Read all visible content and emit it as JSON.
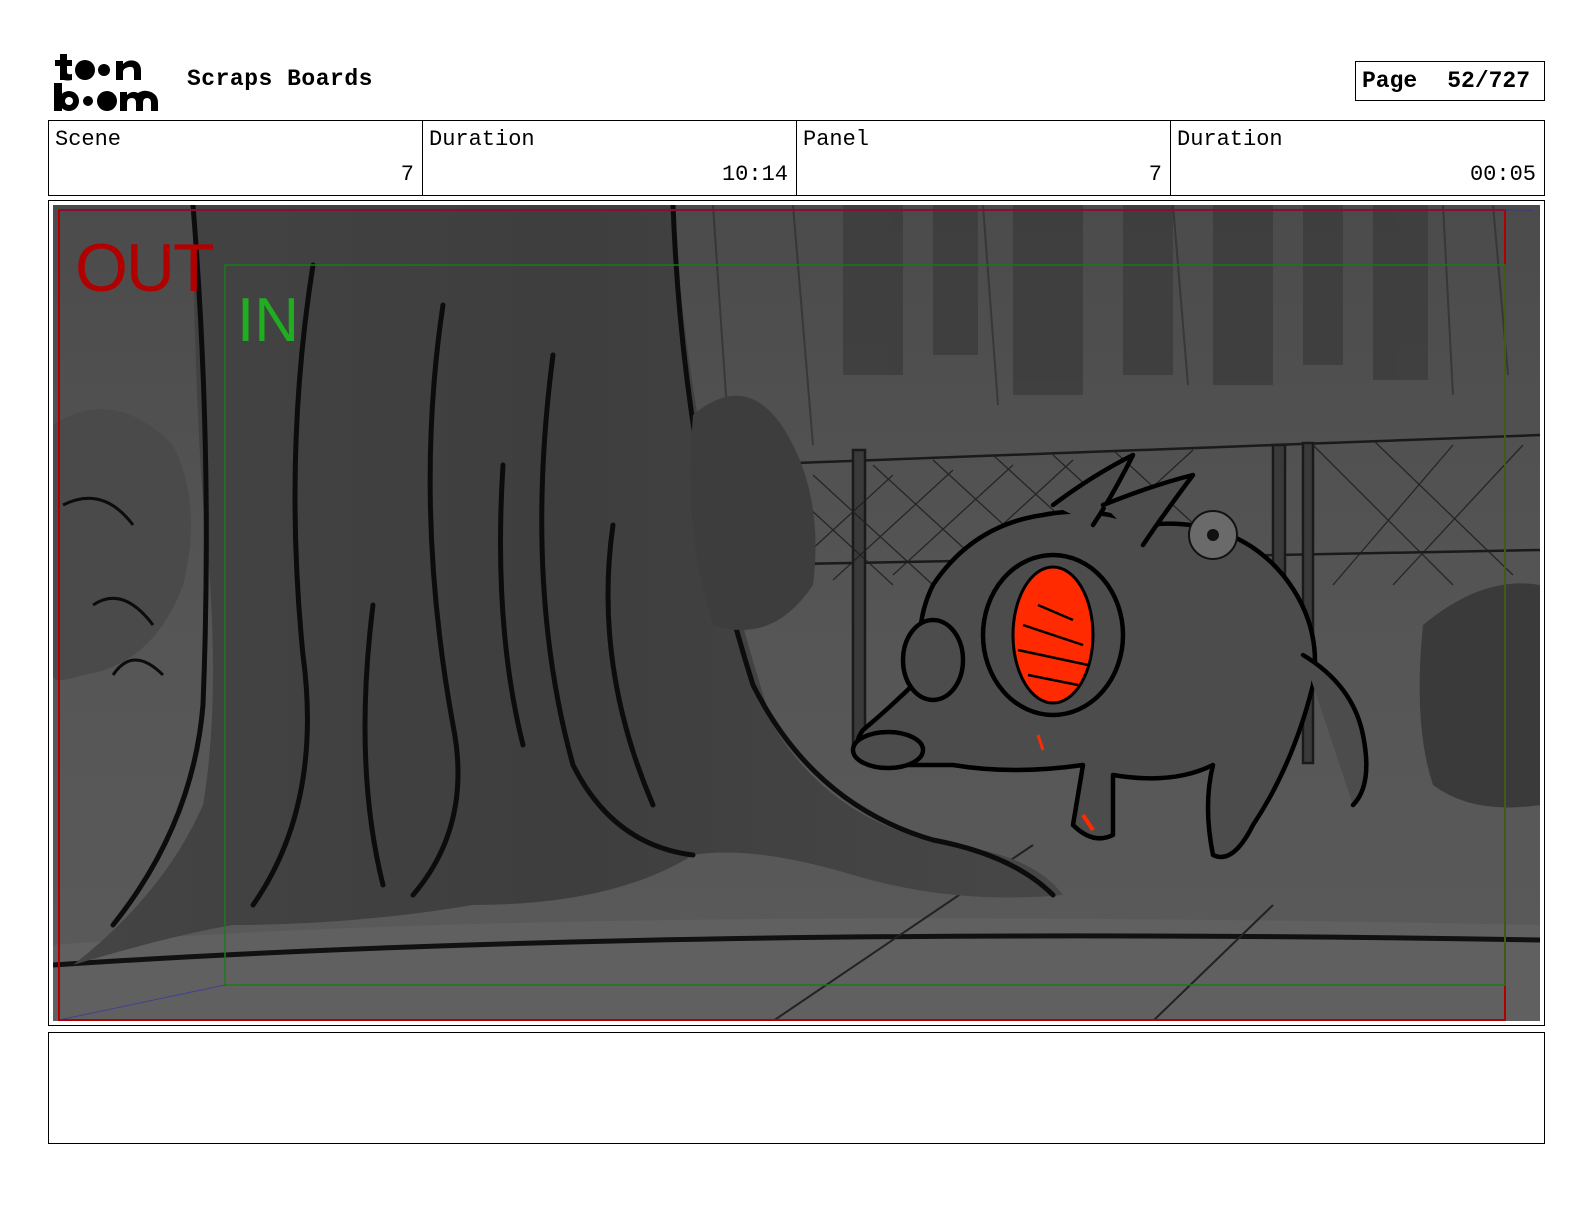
{
  "header": {
    "logo_text": "toon boom",
    "project_title": "Scraps Boards",
    "page_label": "Page",
    "page_number": "52/727"
  },
  "info": {
    "scene_label": "Scene",
    "scene_value": "7",
    "duration_label": "Duration",
    "duration_value": "10:14",
    "panel_label": "Panel",
    "panel_value": "7",
    "panel_duration_label": "Duration",
    "panel_duration_value": "00:05"
  },
  "panel": {
    "out_label": "OUT",
    "in_label": "IN"
  },
  "colors": {
    "out_frame": "#b00000",
    "in_frame": "#1fae1f",
    "accent_red": "#ff2a00"
  }
}
